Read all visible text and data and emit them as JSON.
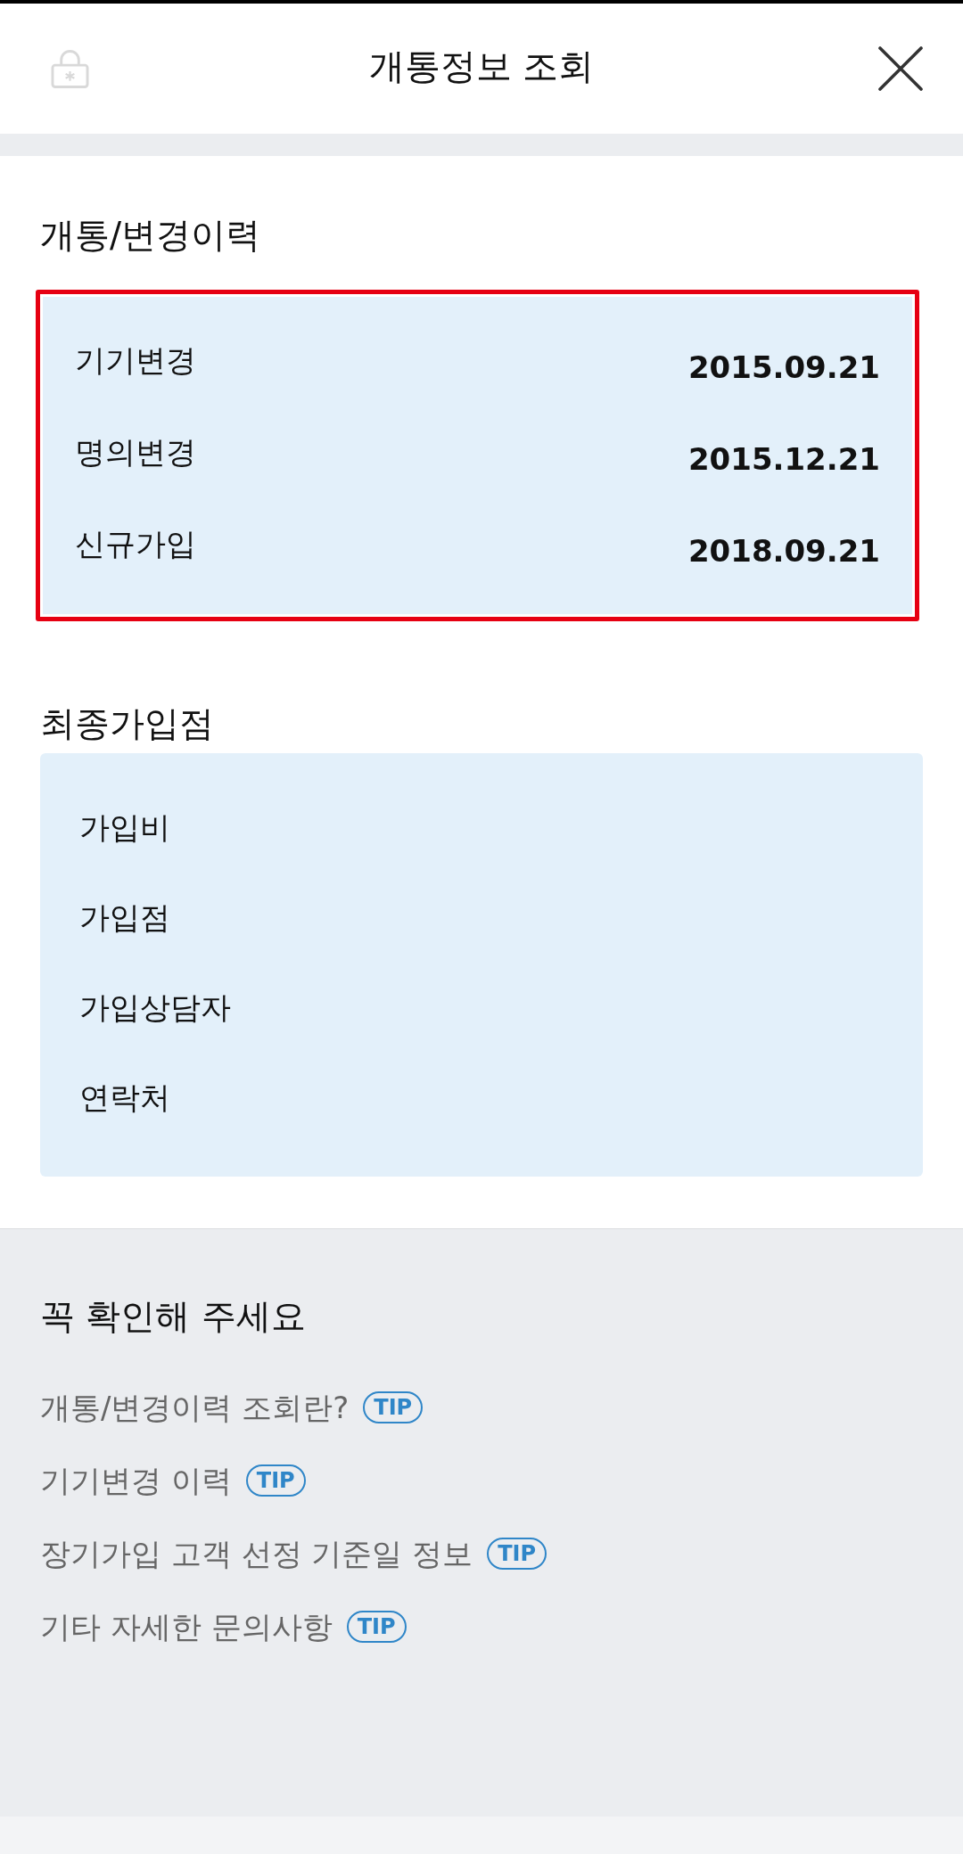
{
  "header": {
    "title": "개통정보 조회"
  },
  "sections": [
    {
      "heading": "개통/변경이력",
      "highlighted": true,
      "rows": [
        {
          "label": "기기변경",
          "value": "2015.09.21"
        },
        {
          "label": "명의변경",
          "value": "2015.12.21"
        },
        {
          "label": "신규가입",
          "value": "2018.09.21"
        }
      ]
    },
    {
      "heading": "최종가입점",
      "highlighted": false,
      "rows": [
        {
          "label": "가입비"
        },
        {
          "label": "가입점"
        },
        {
          "label": "가입상담자"
        },
        {
          "label": "연락처"
        }
      ]
    }
  ],
  "notice": {
    "heading": "꼭 확인해 주세요",
    "links": [
      {
        "text": "개통/변경이력 조회란?",
        "badge": "TIP"
      },
      {
        "text": "기기변경 이력",
        "badge": "TIP"
      },
      {
        "text": "장기가입 고객 선정 기준일 정보",
        "badge": "TIP"
      },
      {
        "text": "기타 자세한 문의사항",
        "badge": "TIP"
      }
    ]
  }
}
